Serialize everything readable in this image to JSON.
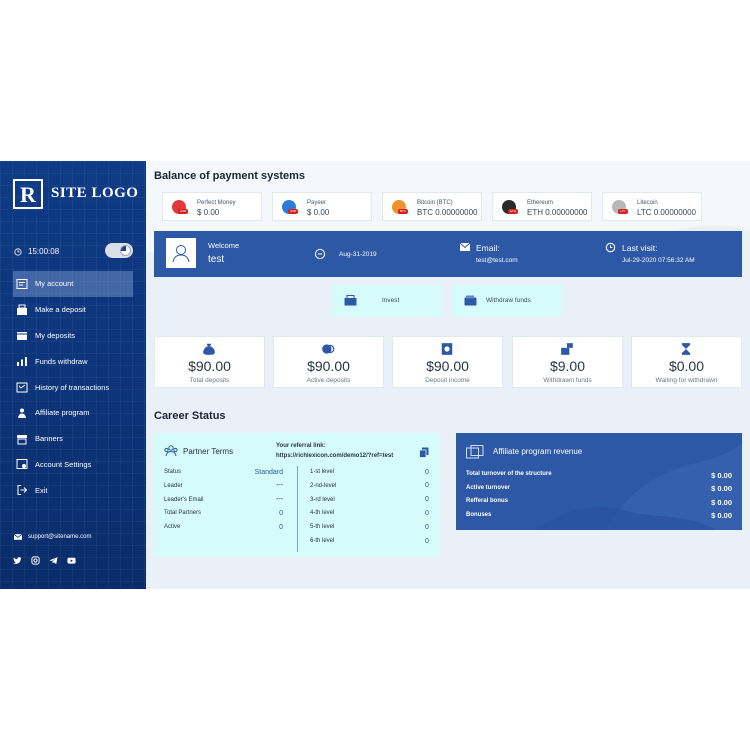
{
  "sidebar": {
    "logo_letter": "R",
    "logo_text": "SITE LOGO",
    "time": "15:00:08",
    "nav": [
      {
        "label": "My account",
        "icon": "account-icon"
      },
      {
        "label": "Make a deposit",
        "icon": "deposit-icon"
      },
      {
        "label": "My deposits",
        "icon": "deposits-icon"
      },
      {
        "label": "Funds withdraw",
        "icon": "withdraw-icon"
      },
      {
        "label": "History of transactions",
        "icon": "history-icon"
      },
      {
        "label": "Affiliate program",
        "icon": "affiliate-icon"
      },
      {
        "label": "Banners",
        "icon": "banners-icon"
      },
      {
        "label": "Account Settings",
        "icon": "settings-icon"
      },
      {
        "label": "Exit",
        "icon": "exit-icon"
      }
    ],
    "active_index": 0,
    "support_email": "support@sitename.com",
    "socials": [
      "twitter-icon",
      "instagram-icon",
      "telegram-icon",
      "youtube-icon"
    ]
  },
  "balance": {
    "title": "Balance of payment systems",
    "systems": [
      {
        "name": "Perfect Money",
        "value": "$ 0.00",
        "tag": "USD",
        "color": "#e23a3a",
        "icon": "perfect-money-icon"
      },
      {
        "name": "Payeer",
        "value": "$ 0.00",
        "tag": "USD",
        "color": "#2f7bd8",
        "icon": "payeer-icon"
      },
      {
        "name": "Bitcoin (BTC)",
        "value": "BTC 0.00000000",
        "tag": "BTC",
        "color": "#f2902d",
        "icon": "bitcoin-icon"
      },
      {
        "name": "Ethereum",
        "value": "ETH 0.00000000",
        "tag": "ETH",
        "color": "#2a2a2a",
        "icon": "ethereum-icon"
      },
      {
        "name": "Litecoin",
        "value": "LTC 0.00000000",
        "tag": "LTC",
        "color": "#b8b8b8",
        "icon": "litecoin-icon"
      }
    ]
  },
  "welcome": {
    "label": "Welcome",
    "username": "test",
    "date": "Aug-31-2019",
    "email_label": "Email:",
    "email": "test@test.com",
    "last_visit_label": "Last visit:",
    "last_visit": "Jul-29-2020 07:56:32 AM"
  },
  "actions": {
    "invest": "Invest",
    "withdraw": "Withdraw funds"
  },
  "stats": [
    {
      "value": "$90.00",
      "label": "Total deposits",
      "icon": "money-bag-icon"
    },
    {
      "value": "$90.00",
      "label": "Active deposits",
      "icon": "coins-icon"
    },
    {
      "value": "$90.00",
      "label": "Deposit income",
      "icon": "income-icon"
    },
    {
      "value": "$9.00",
      "label": "Withdrawn funds",
      "icon": "withdrawn-icon"
    },
    {
      "value": "$0.00",
      "label": "Waiting for withdrawn",
      "icon": "hourglass-icon"
    }
  ],
  "career": {
    "title": "Career Status",
    "partner_title": "Partner Terms",
    "referral_label": "Your referral link:",
    "referral_link": "https://richlexicon.com/demo12/?ref=test",
    "rows": [
      {
        "label": "Status",
        "value": "Standard"
      },
      {
        "label": "Leader",
        "value": "---"
      },
      {
        "label": "Leader's Email",
        "value": "---"
      },
      {
        "label": "Total Partners",
        "value": "0"
      },
      {
        "label": "Active",
        "value": "0"
      }
    ],
    "levels": [
      {
        "label": "1-st level",
        "value": "0"
      },
      {
        "label": "2-nd-level",
        "value": "0"
      },
      {
        "label": "3-rd level",
        "value": "0"
      },
      {
        "label": "4-th level",
        "value": "0"
      },
      {
        "label": "5-th level",
        "value": "0"
      },
      {
        "label": "6-th level",
        "value": "0"
      }
    ]
  },
  "affiliate": {
    "title": "Affiliate program revenue",
    "rows": [
      {
        "label": "Total turnover of the structure",
        "value": "$ 0.00"
      },
      {
        "label": "Active turnover",
        "value": "$ 0.00"
      },
      {
        "label": "Refferal bonus",
        "value": "$ 0.00"
      },
      {
        "label": "Bonuses",
        "value": "$ 0.00"
      }
    ]
  }
}
